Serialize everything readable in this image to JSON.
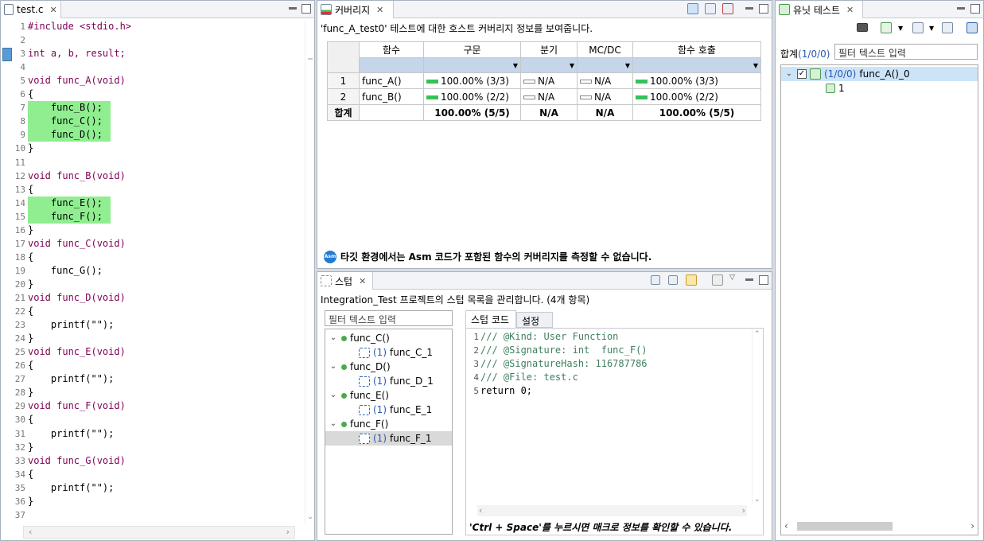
{
  "editor": {
    "tab_title": "test.c",
    "lines": [
      {
        "n": "1",
        "text": "#include <stdio.h>",
        "hl": false
      },
      {
        "n": "2",
        "text": "",
        "hl": false
      },
      {
        "n": "3",
        "text": "int a, b, result;",
        "hl": false
      },
      {
        "n": "4",
        "text": "",
        "hl": false
      },
      {
        "n": "5",
        "text": "void func_A(void)",
        "hl": false
      },
      {
        "n": "6",
        "text": "{",
        "hl": false
      },
      {
        "n": "7",
        "text": "    func_B();",
        "hl": true
      },
      {
        "n": "8",
        "text": "    func_C();",
        "hl": true
      },
      {
        "n": "9",
        "text": "    func_D();",
        "hl": true
      },
      {
        "n": "10",
        "text": "}",
        "hl": false
      },
      {
        "n": "11",
        "text": "",
        "hl": false
      },
      {
        "n": "12",
        "text": "void func_B(void)",
        "hl": false
      },
      {
        "n": "13",
        "text": "{",
        "hl": false
      },
      {
        "n": "14",
        "text": "    func_E();",
        "hl": true
      },
      {
        "n": "15",
        "text": "    func_F();",
        "hl": true
      },
      {
        "n": "16",
        "text": "}",
        "hl": false
      },
      {
        "n": "17",
        "text": "void func_C(void)",
        "hl": false
      },
      {
        "n": "18",
        "text": "{",
        "hl": false
      },
      {
        "n": "19",
        "text": "    func_G();",
        "hl": false
      },
      {
        "n": "20",
        "text": "}",
        "hl": false
      },
      {
        "n": "21",
        "text": "void func_D(void)",
        "hl": false
      },
      {
        "n": "22",
        "text": "{",
        "hl": false
      },
      {
        "n": "23",
        "text": "    printf(\"\");",
        "hl": false
      },
      {
        "n": "24",
        "text": "}",
        "hl": false
      },
      {
        "n": "25",
        "text": "void func_E(void)",
        "hl": false
      },
      {
        "n": "26",
        "text": "{",
        "hl": false
      },
      {
        "n": "27",
        "text": "    printf(\"\");",
        "hl": false
      },
      {
        "n": "28",
        "text": "}",
        "hl": false
      },
      {
        "n": "29",
        "text": "void func_F(void)",
        "hl": false
      },
      {
        "n": "30",
        "text": "{",
        "hl": false
      },
      {
        "n": "31",
        "text": "    printf(\"\");",
        "hl": false
      },
      {
        "n": "32",
        "text": "}",
        "hl": false
      },
      {
        "n": "33",
        "text": "void func_G(void)",
        "hl": false
      },
      {
        "n": "34",
        "text": "{",
        "hl": false
      },
      {
        "n": "35",
        "text": "    printf(\"\");",
        "hl": false
      },
      {
        "n": "36",
        "text": "}",
        "hl": false
      },
      {
        "n": "37",
        "text": "",
        "hl": false
      }
    ]
  },
  "coverage": {
    "tab_title": "커버리지",
    "description": "'func_A_test0' 테스트에 대한 호스트 커버리지 정보를 보여줍니다.",
    "headers": [
      "함수",
      "구문",
      "분기",
      "MC/DC",
      "함수 호출"
    ],
    "rows": [
      {
        "idx": "1",
        "name": "func_A()",
        "stmt": "100.00% (3/3)",
        "branch": "N/A",
        "mcdc": "N/A",
        "call": "100.00% (3/3)"
      },
      {
        "idx": "2",
        "name": "func_B()",
        "stmt": "100.00% (2/2)",
        "branch": "N/A",
        "mcdc": "N/A",
        "call": "100.00% (2/2)"
      }
    ],
    "total": {
      "label": "합계",
      "stmt": "100.00% (5/5)",
      "branch": "N/A",
      "mcdc": "N/A",
      "call": "100.00% (5/5)"
    },
    "notice": "타깃 환경에서는 Asm 코드가 포함된 함수의 커버리지를 측정할 수 없습니다.",
    "notice_icon": "Asm",
    "bar_color": "#37c159"
  },
  "stub": {
    "tab_title": "스텁",
    "description": "Integration_Test 프로젝트의 스텁 목록을 관리합니다. (4개 항목)",
    "filter_placeholder": "필터 텍스트 입력",
    "tree": [
      {
        "func": "func_C()",
        "count": "(1)",
        "stub": "func_C_1",
        "selected": false
      },
      {
        "func": "func_D()",
        "count": "(1)",
        "stub": "func_D_1",
        "selected": false
      },
      {
        "func": "func_E()",
        "count": "(1)",
        "stub": "func_E_1",
        "selected": false
      },
      {
        "func": "func_F()",
        "count": "(1)",
        "stub": "func_F_1",
        "selected": true
      }
    ],
    "tabs": [
      "스텁 코드",
      "설정"
    ],
    "code_lines": [
      {
        "n": "1",
        "text": "/// @Kind: User Function",
        "comment": true
      },
      {
        "n": "2",
        "text": "/// @Signature: int  func_F()",
        "comment": true
      },
      {
        "n": "3",
        "text": "/// @SignatureHash: 116787786",
        "comment": true
      },
      {
        "n": "4",
        "text": "/// @File: test.c",
        "comment": true
      },
      {
        "n": "5",
        "text": "return 0;",
        "comment": false
      }
    ],
    "hint": "'Ctrl + Space'를 누르시면 매크로 정보를 확인할 수 있습니다."
  },
  "unit": {
    "tab_title": "유닛 테스트",
    "summary_label": "합계",
    "summary_counts": "(1/0/0)",
    "filter_placeholder": "필터 텍스트 입력",
    "root_counts": "(1/0/0)",
    "root_name": "func_A()_0",
    "child": "1"
  }
}
